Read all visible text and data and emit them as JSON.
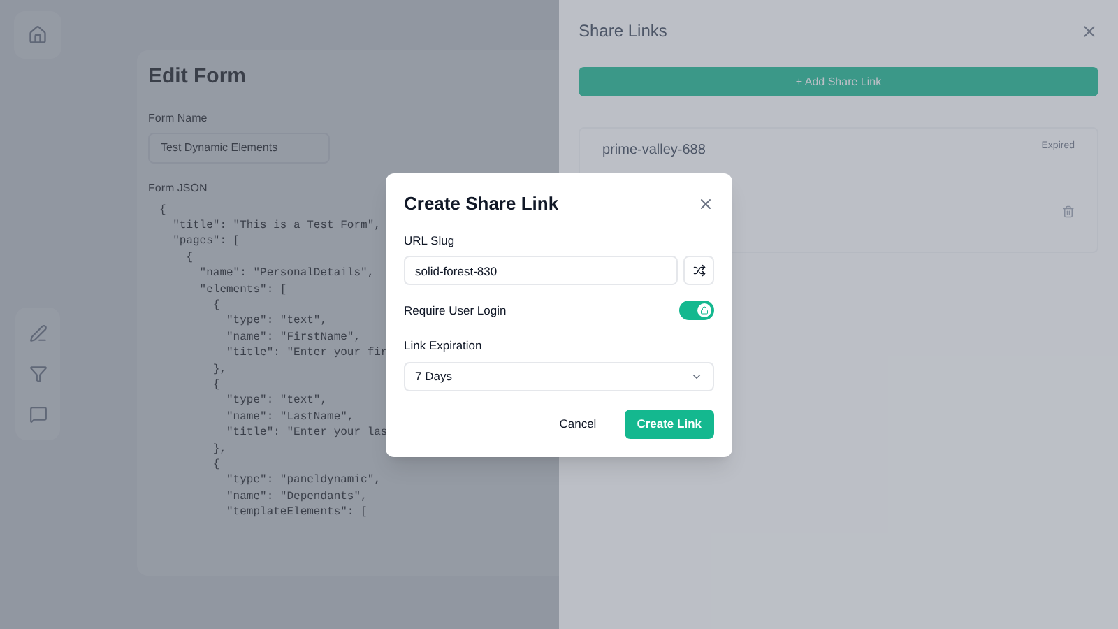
{
  "editor": {
    "title": "Edit Form",
    "name_label": "Form Name",
    "name_value": "Test Dynamic Elements",
    "json_label": "Form JSON",
    "code_lines": [
      "{",
      "  \"title\": \"This is a Test Form\",",
      "  \"pages\": [",
      "    {",
      "      \"name\": \"PersonalDetails\",",
      "      \"elements\": [",
      "        {",
      "          \"type\": \"text\",",
      "          \"name\": \"FirstName\",",
      "          \"title\": \"Enter your fir",
      "        },",
      "        {",
      "          \"type\": \"text\",",
      "          \"name\": \"LastName\",",
      "          \"title\": \"Enter your las",
      "        },",
      "        {",
      "          \"type\": \"paneldynamic\",",
      "          \"name\": \"Dependants\",",
      "          \"templateElements\": ["
    ]
  },
  "drawer": {
    "title": "Share Links",
    "add_button": "+ Add Share Link",
    "links": [
      {
        "slug": "prime-valley-688",
        "status": "Expired"
      }
    ]
  },
  "dialog": {
    "title": "Create Share Link",
    "slug_label": "URL Slug",
    "slug_value": "solid-forest-830",
    "login_label": "Require User Login",
    "login_required": true,
    "expiration_label": "Link Expiration",
    "expiration_value": "7 Days",
    "cancel": "Cancel",
    "create": "Create Link"
  }
}
